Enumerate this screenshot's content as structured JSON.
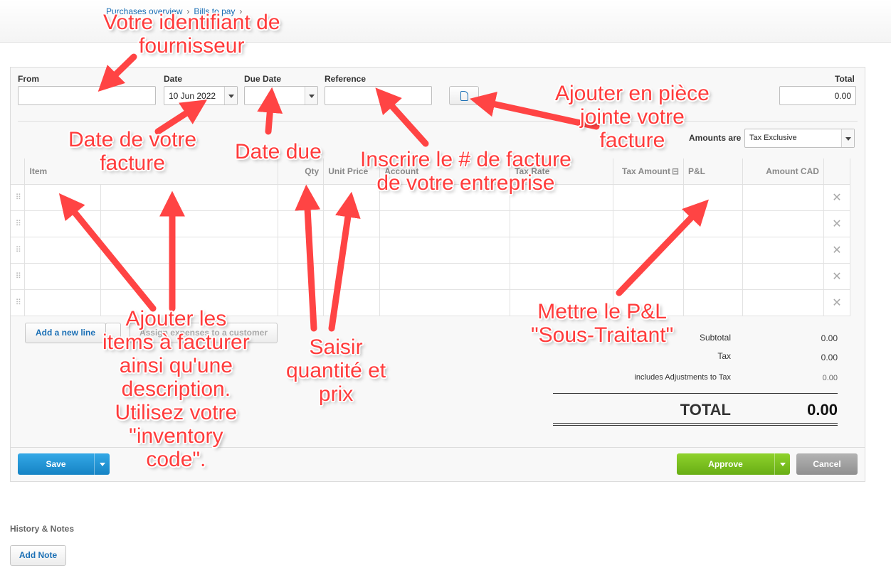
{
  "breadcrumb": {
    "item1": "Purchases overview",
    "item2": "Bills to pay",
    "sep": "›"
  },
  "form": {
    "from_label": "From",
    "from_value": "",
    "date_label": "Date",
    "date_value": "10 Jun 2022",
    "due_label": "Due Date",
    "due_value": "",
    "reference_label": "Reference",
    "reference_value": "",
    "total_label": "Total",
    "total_value": "0.00",
    "amounts_are_label": "Amounts are",
    "amounts_are_value": "Tax Exclusive"
  },
  "grid": {
    "columns": [
      "Item",
      "Qty",
      "Unit Price",
      "Account",
      "Tax Rate",
      "Tax Amount",
      "P&L",
      "Amount CAD"
    ],
    "rows": 5,
    "drag_glyph": "⠿",
    "delete_glyph": "✕",
    "collapse_glyph": "⊟"
  },
  "actions": {
    "add_line": "Add a new line",
    "assign": "Assign expenses to a customer"
  },
  "totals": {
    "subtotal_label": "Subtotal",
    "subtotal_value": "0.00",
    "tax_label": "Tax",
    "tax_value": "0.00",
    "adjust_label": "includes Adjustments to Tax",
    "adjust_value": "0.00",
    "total_label": "TOTAL",
    "total_value": "0.00"
  },
  "footer": {
    "save": "Save",
    "approve": "Approve",
    "cancel": "Cancel"
  },
  "history": {
    "title": "History & Notes",
    "add_note": "Add Note"
  },
  "annotations": {
    "supplier_1": "Votre identifiant de",
    "supplier_2": "fournisseur",
    "attach_1": "Ajouter en pièce",
    "attach_2": "jointe votre",
    "attach_3": "facture",
    "date_1": "Date de votre",
    "date_2": "facture",
    "due": "Date due",
    "invoice_1": "Inscrire le # de facture",
    "invoice_2": "de votre entreprise",
    "pl_1": "Mettre le P&L",
    "pl_2": "\"Sous-Traitant\"",
    "items_1": "Ajouter les",
    "items_2": "items à facturer",
    "items_3": "ainsi qu'une",
    "items_4": "description.",
    "items_5": "Utilisez votre",
    "items_6": "\"inventory",
    "items_7": "code\".",
    "qty_1": "Saisir",
    "qty_2": "quantité et",
    "qty_3": "prix"
  },
  "colors": {
    "annotation": "#ff3b3b",
    "save": "#1a8ed1",
    "approve": "#7cc31a",
    "cancel": "#9a9a9a",
    "link": "#1a6fb5"
  }
}
